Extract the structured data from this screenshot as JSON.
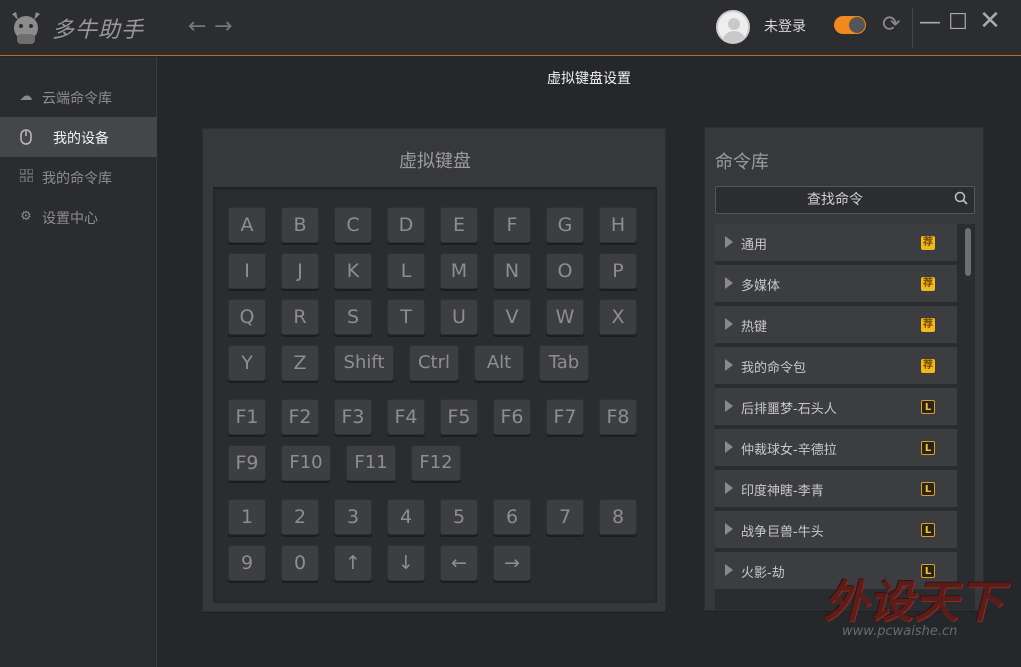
{
  "app": {
    "name": "多牛助手"
  },
  "titlebar": {
    "back_icon": "arrow-left-icon",
    "forward_icon": "arrow-right-icon",
    "login_status": "未登录",
    "toggle_on": true,
    "accent_color": "#f08a1e",
    "win_min": "—",
    "win_max": "☐",
    "win_close": "✕"
  },
  "sidebar": {
    "items": [
      {
        "label": "云端命令库",
        "icon": "cloud-icon",
        "active": false
      },
      {
        "label": "我的设备",
        "icon": "mouse-icon",
        "active": true
      },
      {
        "label": "我的命令库",
        "icon": "grid-icon",
        "active": false
      },
      {
        "label": "设置中心",
        "icon": "gear-icon",
        "active": false
      }
    ]
  },
  "page": {
    "title": "虚拟键盘设置"
  },
  "keyboard": {
    "title": "虚拟键盘",
    "rows": [
      [
        "A",
        "B",
        "C",
        "D",
        "E",
        "F",
        "G",
        "H"
      ],
      [
        "I",
        "J",
        "K",
        "L",
        "M",
        "N",
        "O",
        "P"
      ],
      [
        "Q",
        "R",
        "S",
        "T",
        "U",
        "V",
        "W",
        "X"
      ],
      [
        "Y",
        "Z",
        "Shift",
        "Ctrl",
        "Alt",
        "Tab"
      ],
      [
        "F1",
        "F2",
        "F3",
        "F4",
        "F5",
        "F6",
        "F7",
        "F8"
      ],
      [
        "F9",
        "F10",
        "F11",
        "F12"
      ],
      [
        "1",
        "2",
        "3",
        "4",
        "5",
        "6",
        "7",
        "8"
      ],
      [
        "9",
        "0",
        "↑",
        "↓",
        "←",
        "→"
      ]
    ]
  },
  "commands": {
    "title": "命令库",
    "search_placeholder": "查找命令",
    "items": [
      {
        "name": "通用",
        "badge": "荐",
        "badge_type": "recommend"
      },
      {
        "name": "多媒体",
        "badge": "荐",
        "badge_type": "recommend"
      },
      {
        "name": "热键",
        "badge": "荐",
        "badge_type": "recommend"
      },
      {
        "name": "我的命令包",
        "badge": "荐",
        "badge_type": "recommend"
      },
      {
        "name": "后排噩梦-石头人",
        "badge": "L",
        "badge_type": "lol"
      },
      {
        "name": "仲裁球女-辛德拉",
        "badge": "L",
        "badge_type": "lol"
      },
      {
        "name": "印度神瞎-李青",
        "badge": "L",
        "badge_type": "lol"
      },
      {
        "name": "战争巨兽-牛头",
        "badge": "L",
        "badge_type": "lol"
      },
      {
        "name": "火影-劫",
        "badge": "L",
        "badge_type": "lol"
      }
    ]
  },
  "watermark": {
    "text": "外设天下",
    "url": "www.pcwaishe.cn"
  }
}
